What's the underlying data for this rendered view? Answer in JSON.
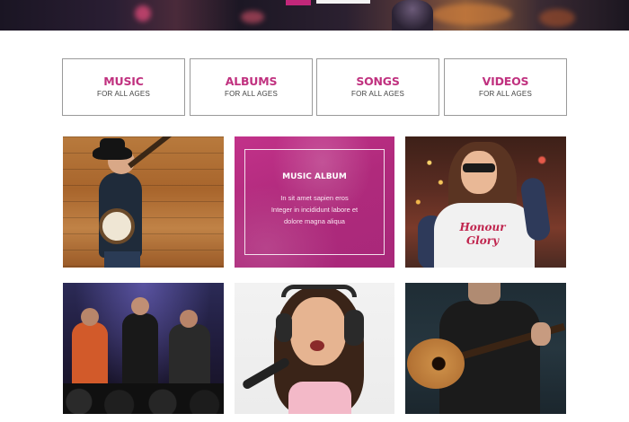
{
  "categories": [
    {
      "title": "MUSIC",
      "subtitle": "FOR ALL AGES"
    },
    {
      "title": "ALBUMS",
      "subtitle": "FOR ALL AGES"
    },
    {
      "title": "SONGS",
      "subtitle": "FOR ALL AGES"
    },
    {
      "title": "VIDEOS",
      "subtitle": "FOR ALL AGES"
    }
  ],
  "album_card": {
    "title": "MUSIC ALBUM",
    "line1": "In sit amet sapien eros",
    "line2": "Integer in incididunt labore et",
    "line3": "dolore magna aliqua"
  },
  "tshirt_print": {
    "line1": "Honour",
    "line2": "Glory"
  },
  "colors": {
    "accent": "#c0317f",
    "album_bg": "#b02a7c",
    "box_border": "#9a9a9a"
  }
}
